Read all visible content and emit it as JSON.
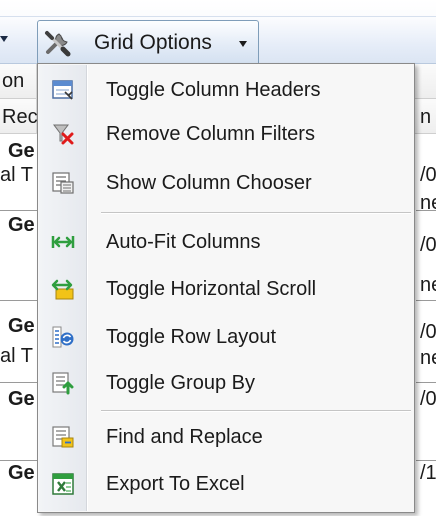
{
  "toolbar": {
    "grid_options_label": "Grid Options"
  },
  "background_grid": {
    "header_left": [
      "on",
      "Rec"
    ],
    "header_right": [
      "n"
    ],
    "left_cells": [
      "Ge",
      "al T",
      "Ge",
      "Ge",
      "al T",
      "Ge",
      "Ge"
    ],
    "right_cells": [
      "/0",
      "ne",
      "/0",
      "ne",
      "/0",
      "ne",
      "/0",
      "/1"
    ]
  },
  "menu": {
    "items": [
      {
        "label": "Toggle Column Headers",
        "icon": "toggle-column-headers-icon"
      },
      {
        "label": "Remove Column Filters",
        "icon": "remove-column-filters-icon"
      },
      {
        "label": "Show Column Chooser",
        "icon": "show-column-chooser-icon"
      },
      {
        "label": "Auto-Fit Columns",
        "icon": "auto-fit-columns-icon"
      },
      {
        "label": "Toggle Horizontal Scroll",
        "icon": "toggle-horizontal-scroll-icon"
      },
      {
        "label": "Toggle Row Layout",
        "icon": "toggle-row-layout-icon"
      },
      {
        "label": "Toggle Group By",
        "icon": "toggle-group-by-icon"
      },
      {
        "label": "Find and Replace",
        "icon": "find-and-replace-icon"
      },
      {
        "label": "Export To Excel",
        "icon": "export-to-excel-icon"
      }
    ]
  },
  "colors": {
    "toolbar_gradient_end": "#dbe5f3",
    "menu_background": "#f7f7f7",
    "menu_border": "#8a8a8a",
    "icon_green": "#2f9e3f",
    "icon_blue": "#2f6fc7",
    "icon_red": "#e01b1b",
    "icon_yellow": "#f2c318"
  }
}
